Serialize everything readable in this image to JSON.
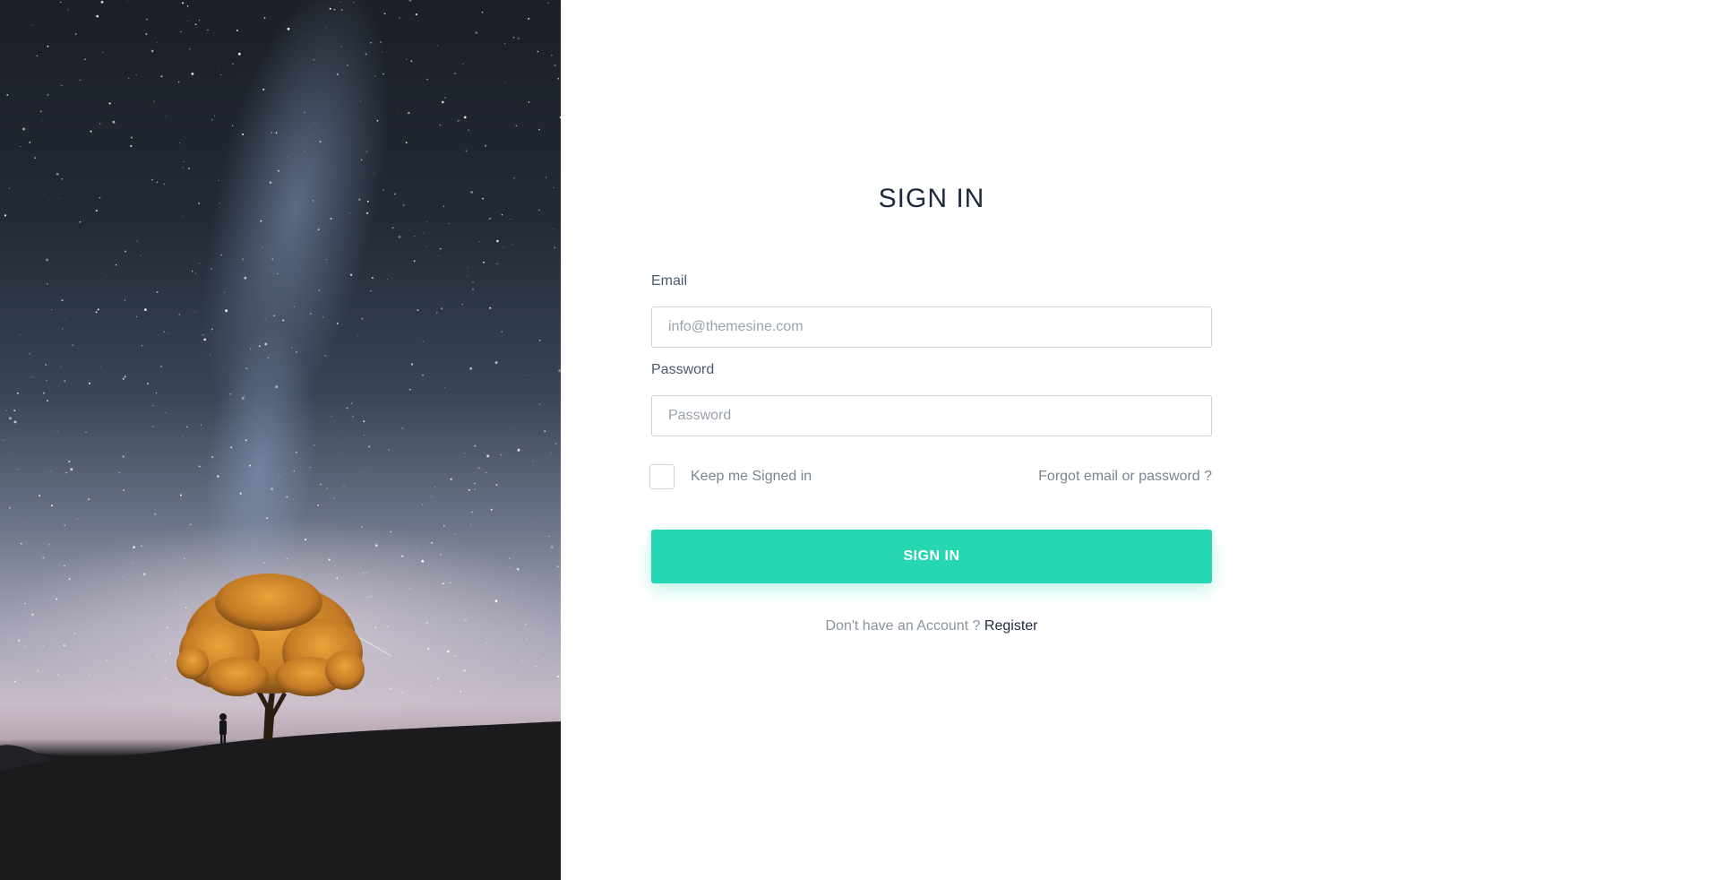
{
  "page": {
    "title": "SIGN IN"
  },
  "form": {
    "email_label": "Email",
    "email_placeholder": "info@themesine.com",
    "email_value": "",
    "password_label": "Password",
    "password_placeholder": "Password",
    "password_value": "",
    "remember_label": "Keep me Signed in",
    "remember_checked": false,
    "forgot_link": "Forgot email or password ?",
    "submit_label": "SIGN IN"
  },
  "footer": {
    "prompt": "Don't have an Account ?",
    "register_link": "Register"
  },
  "colors": {
    "accent": "#27d6b2",
    "heading": "#1c2a3e",
    "muted_text": "#7b8591"
  },
  "hero": {
    "image_subject": "night sky with milky way, lone tree and person silhouette on a hill"
  }
}
